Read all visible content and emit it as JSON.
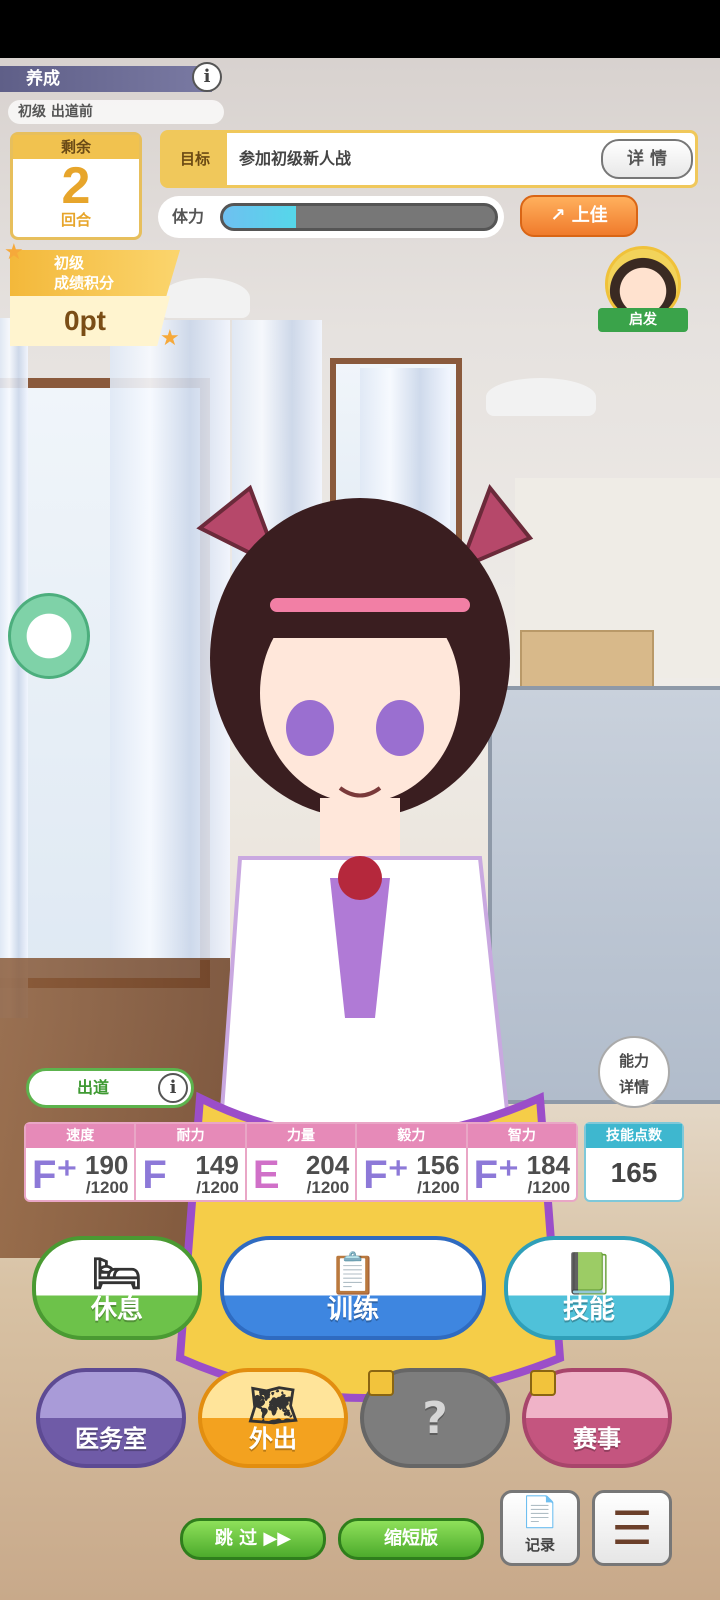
{
  "header": {
    "mode_title": "养成",
    "stage": "初级 出道前",
    "turns_label": "剩余",
    "turns_value": "2",
    "turns_unit": "回合"
  },
  "goal": {
    "tag": "目标",
    "text": "参加初级新人战",
    "details_button": "详 情"
  },
  "energy": {
    "label": "体力",
    "level_fraction": 0.27
  },
  "mood": {
    "label": "上佳",
    "arrow": "↗"
  },
  "score": {
    "line1": "初级",
    "line2": "成绩积分",
    "value": "0pt"
  },
  "coach": {
    "label": "启发"
  },
  "debut_badge": {
    "label": "出道"
  },
  "ability_button": {
    "line1": "能力",
    "line2": "详情"
  },
  "stats": [
    {
      "name": "速度",
      "rank": "F⁺",
      "value": "190",
      "cap": "/1200"
    },
    {
      "name": "耐力",
      "rank": "F",
      "value": "149",
      "cap": "/1200"
    },
    {
      "name": "力量",
      "rank": "E",
      "value": "204",
      "cap": "/1200"
    },
    {
      "name": "毅力",
      "rank": "F⁺",
      "value": "156",
      "cap": "/1200"
    },
    {
      "name": "智力",
      "rank": "F⁺",
      "value": "184",
      "cap": "/1200"
    }
  ],
  "skill_points": {
    "label": "技能点数",
    "value": "165"
  },
  "actions": {
    "rest": "休息",
    "train": "训练",
    "skill": "技能",
    "infirmary": "医务室",
    "outing": "外出",
    "locked": "?",
    "race": "赛事"
  },
  "bottom": {
    "skip": "跳 过 ▶▶",
    "shorten": "缩短版",
    "log": "记录"
  },
  "colors": {
    "accent_gold": "#f0c85b",
    "energy_fill": "#55d7ea",
    "mood_orange": "#f07b2c",
    "stat_header_pink": "#e68ab8",
    "skill_header_teal": "#3eb7cf"
  }
}
